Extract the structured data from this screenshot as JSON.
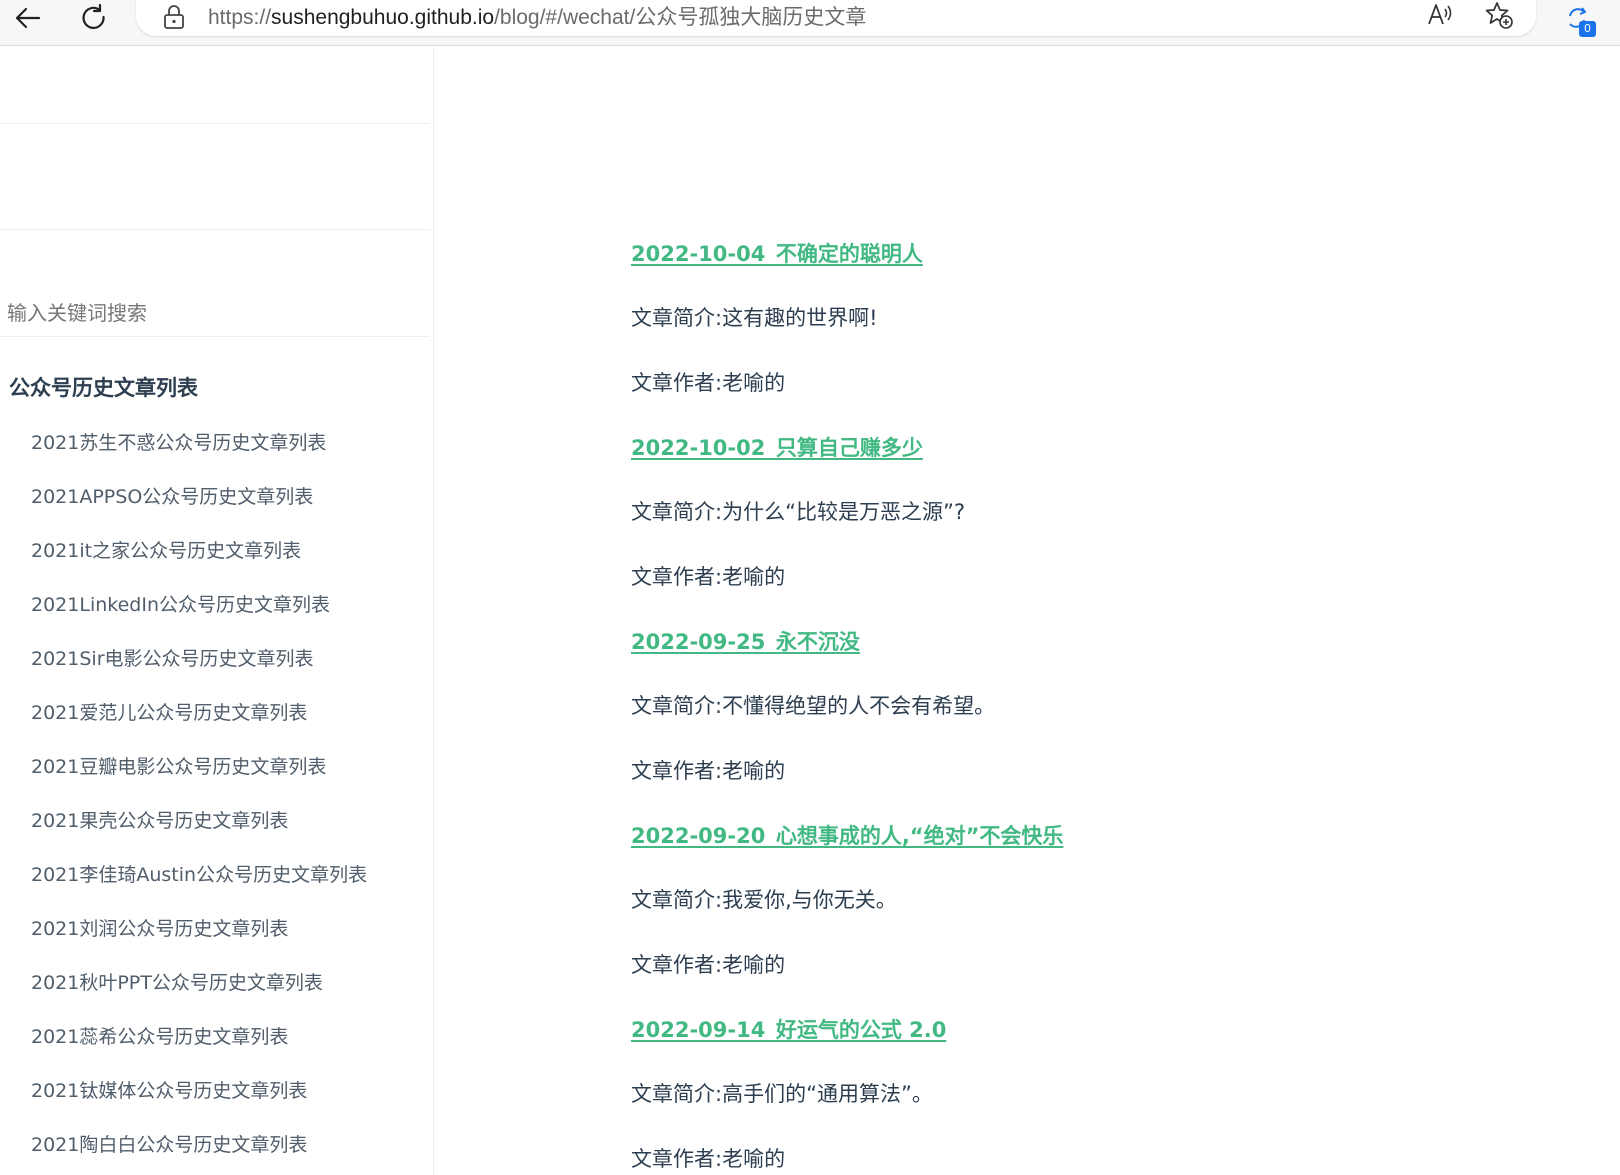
{
  "browser": {
    "url_prefix": "https://",
    "url_host": "sushengbuhuo.github.io",
    "url_path": "/blog/#/wechat/公众号孤独大脑历史文章",
    "extensions_badge": "0",
    "icons": [
      "back-arrow-icon",
      "reload-icon",
      "lock-icon",
      "read-aloud-icon",
      "favorite-star-icon",
      "extensions-icon"
    ]
  },
  "sidebar": {
    "search_placeholder": "输入关键词搜索",
    "heading": "公众号历史文章列表",
    "items": [
      "2021苏生不惑公众号历史文章列表",
      "2021APPSO公众号历史文章列表",
      "2021it之家公众号历史文章列表",
      "2021LinkedIn公众号历史文章列表",
      "2021Sir电影公众号历史文章列表",
      "2021爱范儿公众号历史文章列表",
      "2021豆瓣电影公众号历史文章列表",
      "2021果壳公众号历史文章列表",
      "2021李佳琦Austin公众号历史文章列表",
      "2021刘润公众号历史文章列表",
      "2021秋叶PPT公众号历史文章列表",
      "2021蕊希公众号历史文章列表",
      "2021钛媒体公众号历史文章列表",
      "2021陶白白公众号历史文章列表"
    ]
  },
  "articles": [
    {
      "title": "2022-10-04_不确定的聪明人",
      "summary": "文章简介:这有趣的世界啊!",
      "author": "文章作者:老喻的"
    },
    {
      "title": "2022-10-02_只算自己赚多少",
      "summary": "文章简介:为什么“比较是万恶之源”?",
      "author": "文章作者:老喻的"
    },
    {
      "title": "2022-09-25_永不沉没",
      "summary": "文章简介:不懂得绝望的人不会有希望。",
      "author": "文章作者:老喻的"
    },
    {
      "title": "2022-09-20_心想事成的人,“绝对”不会快乐",
      "summary": "文章简介:我爱你,与你无关。",
      "author": "文章作者:老喻的"
    },
    {
      "title": "2022-09-14_好运气的公式 2.0",
      "summary": "文章简介:高手们的“通用算法”。",
      "author": "文章作者:老喻的"
    }
  ],
  "colors": {
    "link": "#42b983",
    "text": "#2c3e50",
    "sidebar_text": "#505d6b"
  }
}
